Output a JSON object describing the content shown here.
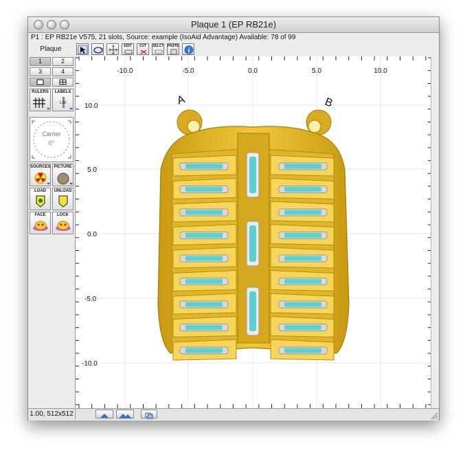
{
  "window": {
    "title": "Plaque 1 (EP RB21e)",
    "info": "P1 : EP RB21e V575, 21 slots, Source: example (IsoAid Advantage) Available: 78 of 99"
  },
  "toolbar": {
    "plaque_label": "Plaque",
    "buttons": [
      {
        "name": "select-tool",
        "label": ""
      },
      {
        "name": "rotate-tool",
        "label": ""
      },
      {
        "name": "move-tool",
        "label": ""
      },
      {
        "name": "edit",
        "label": "EDIT"
      },
      {
        "name": "cut",
        "label": "CUT"
      },
      {
        "name": "select",
        "label": "SELCT"
      },
      {
        "name": "paste",
        "label": "PASTE"
      },
      {
        "name": "info",
        "label": ""
      }
    ]
  },
  "left_panel": {
    "view_buttons": [
      "1",
      "2",
      "3",
      "4"
    ],
    "rulers_label": "RULERS",
    "labels_label": "LABELS",
    "labels_value": "1.00",
    "carrier_label": "Carrier",
    "carrier_angle": "0°",
    "sources_label": "SOURCES",
    "picture_label": "PICTURE",
    "load_label": "LOAD",
    "unload_label": "UNLOAD",
    "face_label": "FACE",
    "lock_label": "LOCK"
  },
  "ruler": {
    "x_ticks": [
      "-10.0",
      "-5.0",
      "0.0",
      "5.0",
      "10.0"
    ],
    "y_ticks": [
      "10.0",
      "5.0",
      "0.0",
      "-5.0",
      "-10.0"
    ]
  },
  "plaque": {
    "label_a": "A",
    "label_b": "B",
    "slots": 21,
    "colors": {
      "body": "#e8bd2a",
      "seed": "#5ccfcf"
    }
  },
  "status": {
    "zoom_text": "1.00, 512x512"
  }
}
